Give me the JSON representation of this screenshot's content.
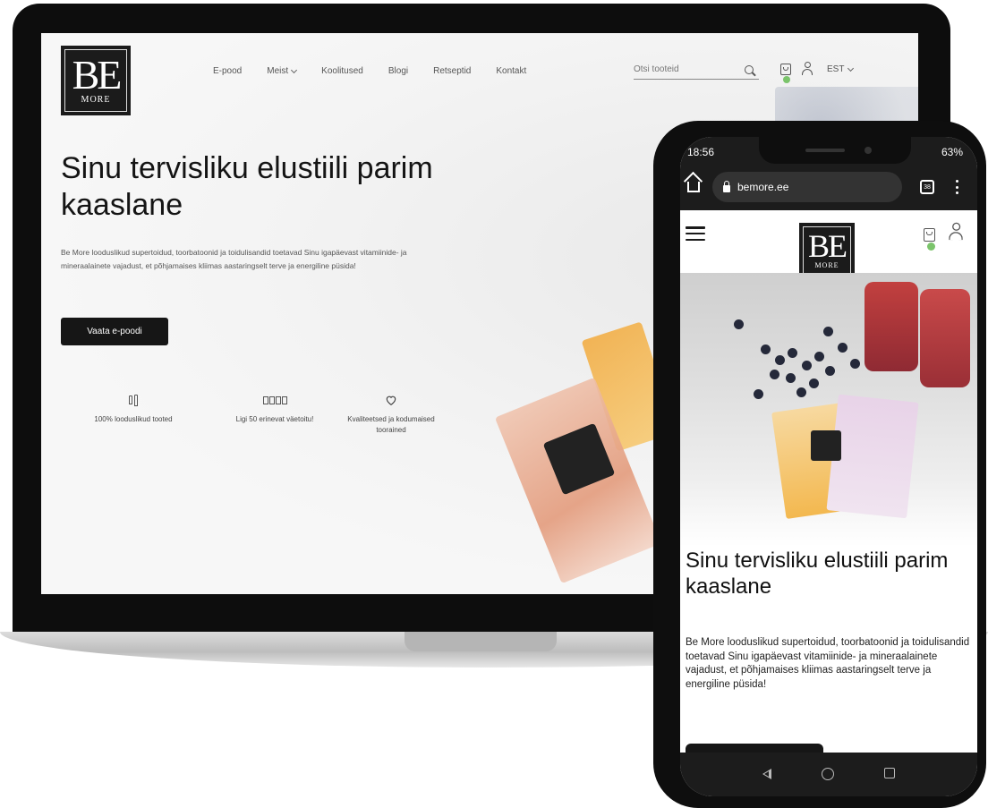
{
  "brand": {
    "logo_top": "BE",
    "logo_bottom": "MORE"
  },
  "desktop": {
    "nav": [
      {
        "label": "E-pood",
        "has_dropdown": false
      },
      {
        "label": "Meist",
        "has_dropdown": true
      },
      {
        "label": "Koolitused",
        "has_dropdown": false
      },
      {
        "label": "Blogi",
        "has_dropdown": false
      },
      {
        "label": "Retseptid",
        "has_dropdown": false
      },
      {
        "label": "Kontakt",
        "has_dropdown": false
      }
    ],
    "search": {
      "placeholder": "Otsi tooteid"
    },
    "language": "EST",
    "hero": {
      "title": "Sinu tervisliku elustiili parim kaaslane",
      "description": "Be More looduslikud supertoidud, toorbatoonid ja toidulisandid toetavad Sinu igapäevast vitamiinide- ja mineraalainete vajadust, et põhjamaises kliimas aastaringselt terve ja energiline püsida!",
      "cta_label": "Vaata e-poodi"
    },
    "features": [
      {
        "icon": "bottles-icon",
        "text": "100% looduslikud tooted"
      },
      {
        "icon": "boxes-icon",
        "text": "Ligi 50 erinevat väetoitu!"
      },
      {
        "icon": "heart-icon",
        "text": "Kvaliteetsed ja kodumaised toorained"
      }
    ]
  },
  "mobile": {
    "status": {
      "time": "18:56",
      "battery": "63%"
    },
    "browser": {
      "url": "bemore.ee",
      "tab_count": "38"
    },
    "hero": {
      "title": "Sinu tervisliku elustiili parim kaaslane",
      "description": "Be More looduslikud supertoidud, toorbatoonid ja toidulisandid toetavad Sinu igapäevast vitamiinide- ja mineraalainete vajadust, et põhjamaises kliimas aastaringselt terve ja energiline püsida!"
    }
  },
  "colors": {
    "dark": "#161616",
    "accent_green": "#7bc46b",
    "device_frame": "#0d0d0d"
  }
}
